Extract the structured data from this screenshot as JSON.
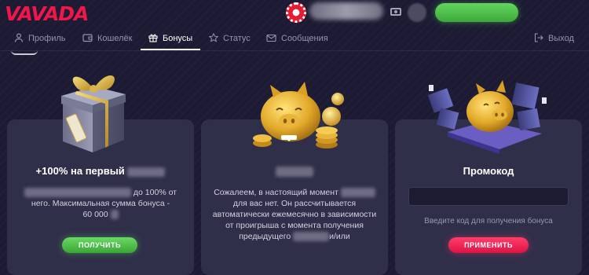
{
  "header": {
    "logo_text": "VAVADA",
    "casino_chip_icon": "poker-chip-icon",
    "wallet_icon": "wallet-icon"
  },
  "nav": {
    "items": [
      {
        "label": "Профиль",
        "icon": "user-icon"
      },
      {
        "label": "Кошелёк",
        "icon": "wallet-icon"
      },
      {
        "label": "Бонусы",
        "icon": "gift-icon"
      },
      {
        "label": "Статус",
        "icon": "star-icon"
      },
      {
        "label": "Сообщения",
        "icon": "envelope-icon"
      }
    ],
    "active": "Бонусы",
    "logout": {
      "label": "Выход",
      "icon": "logout-icon"
    }
  },
  "cards": [
    {
      "title": "+100% на первый",
      "desc_line1_end": "до 100% от",
      "desc_line2": "него. Максимальная сумма бонуса -",
      "desc_line3": "60 000",
      "button": "ПОЛУЧИТЬ",
      "art": "gift-box-illustration"
    },
    {
      "desc_line1": "Сожалеем, в настоящий момент",
      "desc_line2": "для вас нет. Он рассчитывается",
      "desc_line3": "автоматически ежемесячно в зависимости",
      "desc_line4": "от проигрыша с момента получения",
      "desc_line5_start": "предыдущего",
      "desc_line5_end": "и/или",
      "art": "piggy-bank-coins-illustration"
    },
    {
      "title": "Промокод",
      "input_value": "",
      "hint": "Введите код для получения бонуса",
      "button": "ПРИМЕНИТЬ",
      "art": "piggy-bank-gifts-illustration"
    }
  ],
  "colors": {
    "background": "#1c1b33",
    "card": "#302f4a",
    "logo": "#f0164a",
    "green_button": "#3ea83b",
    "red_button": "#e51646"
  }
}
